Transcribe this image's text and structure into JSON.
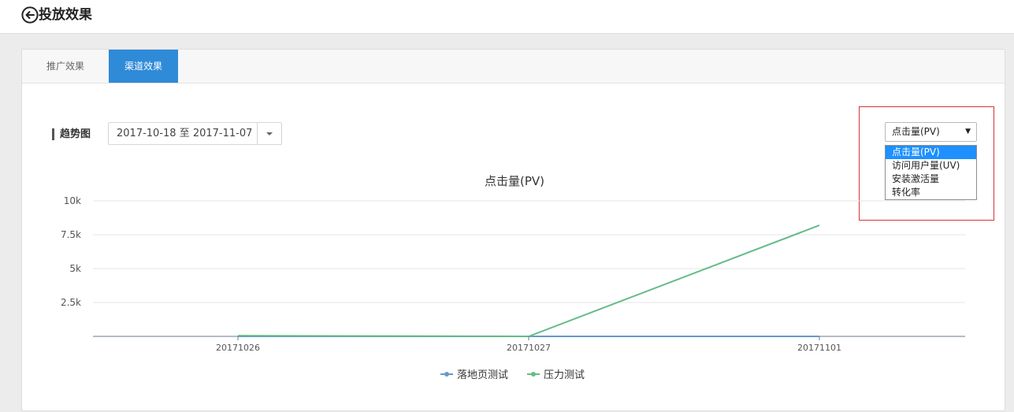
{
  "header": {
    "title": "投放效果",
    "back_icon": "arrow-left-circle-icon"
  },
  "tabs": [
    {
      "label": "推广效果",
      "active": false
    },
    {
      "label": "渠道效果",
      "active": true
    }
  ],
  "filters": {
    "trend_label": "趋势图",
    "date_range": "2017-10-18 至 2017-11-07",
    "metric_select": {
      "value": "点击量(PV)",
      "options": [
        "点击量(PV)",
        "访问用户量(UV)",
        "安装激活量",
        "转化率"
      ]
    }
  },
  "colors": {
    "accent": "#2f8ad8",
    "highlight": "#d2343c",
    "series_blue": "#6699cc",
    "series_green": "#66bb88"
  },
  "chart_data": {
    "type": "line",
    "title": "点击量(PV)",
    "categories": [
      "20171026",
      "20171027",
      "20171101"
    ],
    "y_ticks": [
      "10k",
      "7.5k",
      "5k",
      "2.5k"
    ],
    "ylim": [
      0,
      10000
    ],
    "grid": true,
    "legend_position": "bottom",
    "series": [
      {
        "name": "落地页测试",
        "values": [
          0,
          0,
          0
        ]
      },
      {
        "name": "压力测试",
        "values": [
          50,
          0,
          8200
        ]
      }
    ]
  }
}
